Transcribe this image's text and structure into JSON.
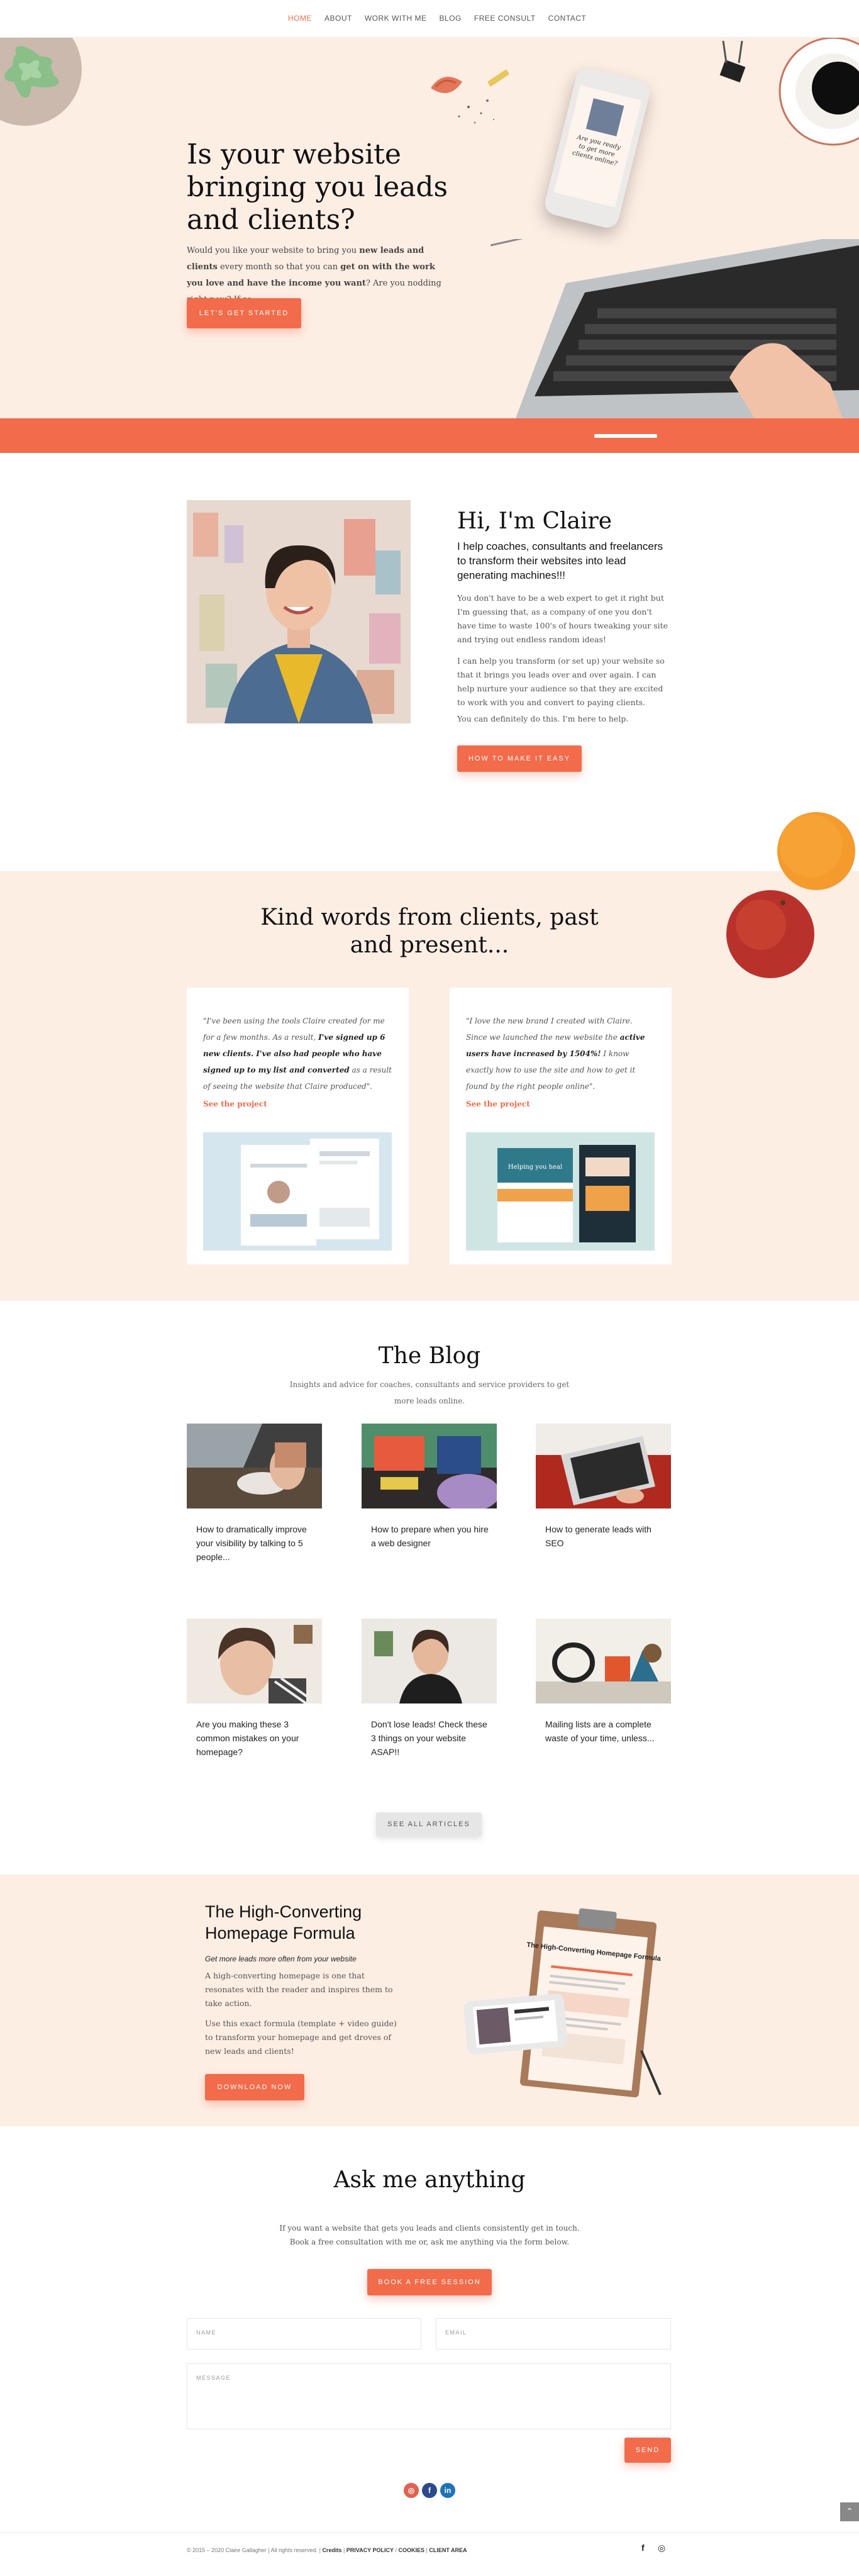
{
  "nav": {
    "items": [
      "HOME",
      "ABOUT",
      "WORK WITH ME",
      "BLOG",
      "FREE CONSULT",
      "CONTACT"
    ]
  },
  "hero": {
    "title": "Is your website bringing you leads and clients?",
    "text_1": "Would you like your website to bring you ",
    "text_bold_1": "new leads and clients",
    "text_2": " every month so that you can ",
    "text_bold_2": "get on with the work you love and have the income you want",
    "text_3": "? Are you nodding right now? If so...",
    "button": "LET'S GET STARTED",
    "phone_text": "Are you ready to get more clients online?"
  },
  "about": {
    "title": "Hi, I'm Claire",
    "subtitle": "I help coaches, consultants and freelancers to transform their websites into lead generating machines!!!",
    "p1": "You don't have to be a web expert to get it right but I'm guessing that, as a company of one you don't have time to waste 100's of hours tweaking your site and trying out endless random ideas!",
    "p2": "I can help you transform (or set up) your website so that it brings you leads over and over again. I can help nurture your audience so that they are excited to work with you and convert to paying clients.",
    "p3": "You can definitely do this. I'm here to help.",
    "button": "HOW TO MAKE IT EASY"
  },
  "testimonials": {
    "title": "Kind words from clients, past and present...",
    "cards": [
      {
        "q1": "\"I've been using the tools Claire created for me for a few months. As a result, ",
        "qb": "I've signed up 6 new clients. I've also had people who have signed up to my list and converted",
        "q2": " as a result of seeing the website that Claire produced\".",
        "link": "See the project"
      },
      {
        "q1": "\"I love the new brand I created with Claire. Since we launched the new website the ",
        "qb": "active users have increased by 1504%!",
        "q2": " I know exactly how to use the site and how to get it found by the right people online\".",
        "link": "See the project",
        "mock_title": "Helping you heal"
      }
    ]
  },
  "blog": {
    "title": "The Blog",
    "subtitle": "Insights and advice for coaches, consultants and service providers to get more leads online.",
    "posts": [
      "How to dramatically improve your visibility by talking to 5 people...",
      "How to prepare when you hire a web designer",
      "How to generate leads with SEO",
      "Are you making these 3 common mistakes on your homepage?",
      "Don't lose leads! Check these 3 things on your website ASAP!!",
      "Mailing lists are a complete waste of your time, unless..."
    ],
    "button": "SEE ALL ARTICLES"
  },
  "formula": {
    "title": "The High-Converting Homepage Formula",
    "tagline": "Get more leads more often from your website",
    "p1": "A high-converting homepage is one that resonates with the reader and inspires them to take action.",
    "p2": "Use this exact formula (template + video guide) to transform your homepage and get droves of new leads and clients!",
    "button": "DOWNLOAD NOW",
    "doc_title": "The High-Converting Homepage Formula"
  },
  "contact": {
    "title": "Ask me anything",
    "text_1": "If you want a website that gets you leads and clients consistently get in touch.",
    "text_2": "Book a free consultation with me or, ask me anything via the form below.",
    "button": "BOOK A FREE SESSION",
    "name_placeholder": "NAME",
    "email_placeholder": "EMAIL",
    "message_placeholder": "MESSAGE",
    "send": "SEND"
  },
  "social": [
    "instagram-icon",
    "facebook-icon",
    "linkedin-icon"
  ],
  "footer": {
    "copyright": "© 2015 – 2020 Claire Gallagher | All rights reserved. |",
    "links": [
      "Credits",
      "PRIVACY POLICY",
      "COOKIES",
      "CLIENT AREA"
    ]
  },
  "colors": {
    "accent": "#f26b4a",
    "peach_bg": "#fdeee4",
    "text": "#111111"
  }
}
